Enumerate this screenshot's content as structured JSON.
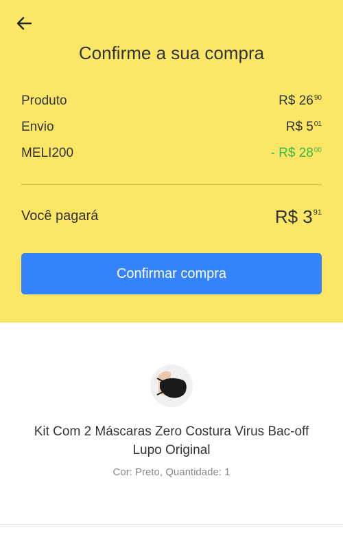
{
  "header": {
    "title": "Confirme a sua compra"
  },
  "summary": [
    {
      "label": "Produto",
      "amount": "R$ 26",
      "cents": "90",
      "accent": false
    },
    {
      "label": "Envio",
      "amount": "R$ 5",
      "cents": "01",
      "accent": false
    },
    {
      "label": "MELI200",
      "amount": "- R$ 28",
      "cents": "00",
      "accent": true
    }
  ],
  "total": {
    "label": "Você pagará",
    "amount": "R$ 3",
    "cents": "91"
  },
  "confirm_button": {
    "label": "Confirmar compra"
  },
  "product": {
    "name": "Kit Com 2 Máscaras Zero Costura Virus Bac-off Lupo Original",
    "details": "Cor: Preto, Quantidade: 1"
  },
  "colors": {
    "header_bg": "#fbe765",
    "button": "#3483fa",
    "discount": "#39b54a"
  }
}
